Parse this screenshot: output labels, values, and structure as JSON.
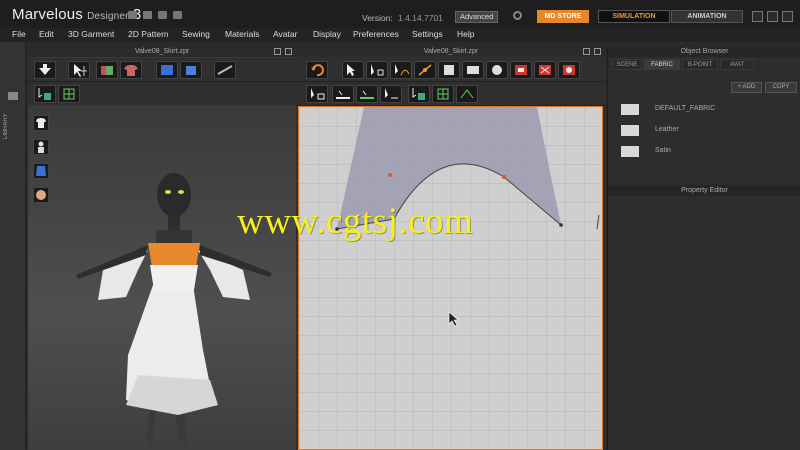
{
  "app": {
    "name": "Marvelous",
    "sub": "Designer",
    "major": "3"
  },
  "version": {
    "label": "Version:",
    "value": "1.4.14.7701"
  },
  "edition_badge": "Advanced",
  "mode_buttons": {
    "store": "MD STORE",
    "simulation": "SIMULATION",
    "animation": "ANIMATION"
  },
  "menu": [
    "File",
    "Edit",
    "3D Garment",
    "2D Pattern",
    "Sewing",
    "Materials",
    "Avatar",
    "Display",
    "Preferences",
    "Settings",
    "Help"
  ],
  "library_label": "LIBRARY",
  "window_3d": {
    "title": "Valve08_Skirt.zpr"
  },
  "window_2d": {
    "title": "Valve08_Skirt.zpr"
  },
  "object_browser": {
    "title": "Object Browser",
    "tabs": [
      "SCENE",
      "FABRIC",
      "B-POINT",
      "AVAT"
    ],
    "active_tab": "FABRIC",
    "add_label": "+ ADD",
    "copy_label": "COPY",
    "fabrics": [
      "DEFAULT_FABRIC",
      "Leather",
      "Satin"
    ]
  },
  "property_editor": {
    "title": "Property Editor"
  },
  "watermark": "www.cgtsj.com",
  "colors": {
    "accent_orange": "#e8862a",
    "selection_border": "#e07a2a",
    "pattern_fill": "#9b9bb0",
    "watermark": "#f7ef1e",
    "bodice_orange": "#e8892e"
  }
}
